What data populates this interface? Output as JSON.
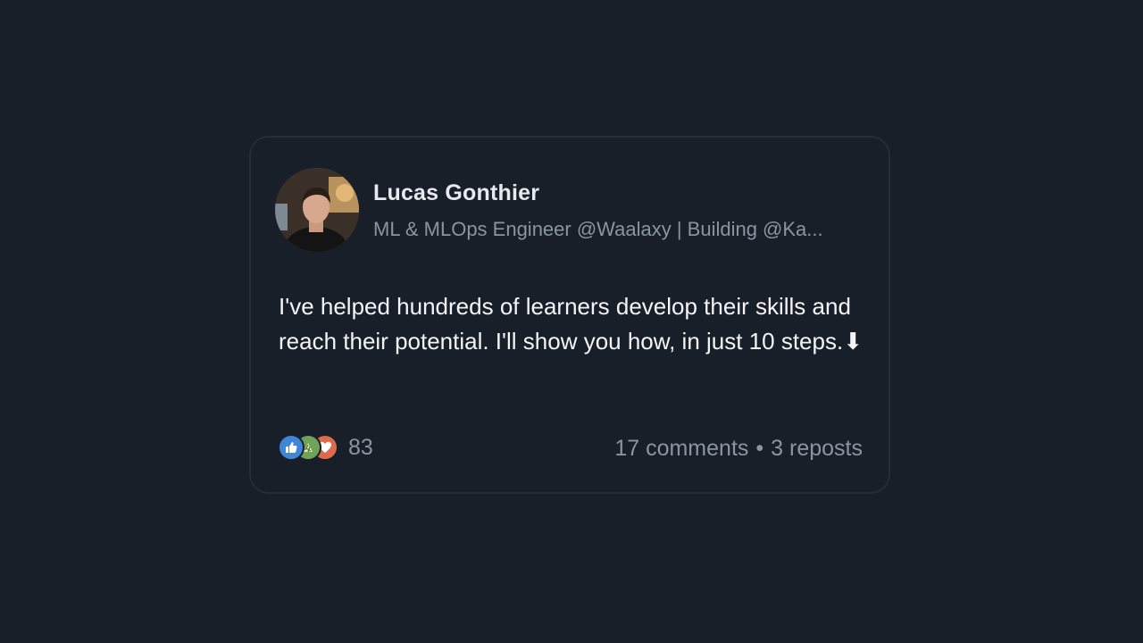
{
  "author": {
    "name": "Lucas Gonthier",
    "headline": "ML & MLOps Engineer @Waalaxy | Building @Ka..."
  },
  "post": {
    "text": "I've helped hundreds of learners develop their skills and reach their potential. I'll show you how, in just 10 steps.⬇"
  },
  "engagement": {
    "reaction_icons": [
      "like-icon",
      "celebrate-icon",
      "love-icon"
    ],
    "reaction_count": "83",
    "comments": "17 comments",
    "separator": "•",
    "reposts": "3 reposts"
  },
  "colors": {
    "background": "#181f29",
    "card_border": "#252d38",
    "name_text": "#e6e9ee",
    "muted_text": "#8b94a1",
    "like": "#3f86d8",
    "celebrate": "#6ea35a",
    "love": "#dd6a4a"
  }
}
